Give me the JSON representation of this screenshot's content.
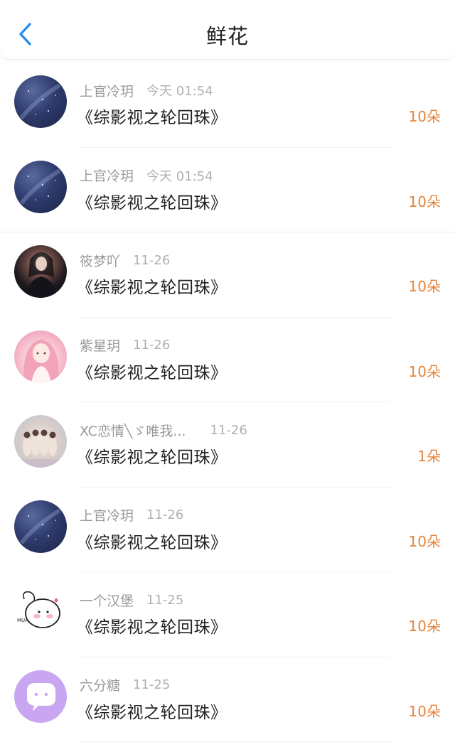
{
  "header": {
    "title": "鲜花",
    "back_icon": "chevron-left-icon",
    "accent": "#2a8cf0"
  },
  "colors": {
    "count": "#e8833a",
    "meta": "#9a9a9a"
  },
  "rows": [
    {
      "user": "上官冷玥",
      "time": "今天 01:54",
      "title": "《综影视之轮回珠》",
      "count": "10朵",
      "avatar": "starry-sky-avatar"
    },
    {
      "user": "上官冷玥",
      "time": "今天 01:54",
      "title": "《综影视之轮回珠》",
      "count": "10朵",
      "avatar": "starry-sky-avatar"
    },
    {
      "user": "筱梦吖",
      "time": "11-26",
      "title": "《综影视之轮回珠》",
      "count": "10朵",
      "avatar": "girl-photo-avatar"
    },
    {
      "user": "紫星玥",
      "time": "11-26",
      "title": "《综影视之轮回珠》",
      "count": "10朵",
      "avatar": "anime-girl-avatar"
    },
    {
      "user": "XC恋情╲ゞ唯我...",
      "time": "11-26",
      "title": "《综影视之轮回珠》",
      "count": "1朵",
      "avatar": "group-photo-avatar"
    },
    {
      "user": "上官冷玥",
      "time": "11-26",
      "title": "《综影视之轮回珠》",
      "count": "10朵",
      "avatar": "starry-sky-avatar"
    },
    {
      "user": "一个汉堡",
      "time": "11-25",
      "title": "《综影视之轮回珠》",
      "count": "10朵",
      "avatar": "cartoon-sticker-avatar"
    },
    {
      "user": "六分糖",
      "time": "11-25",
      "title": "《综影视之轮回珠》",
      "count": "10朵",
      "avatar": "chat-bubble-avatar"
    }
  ]
}
